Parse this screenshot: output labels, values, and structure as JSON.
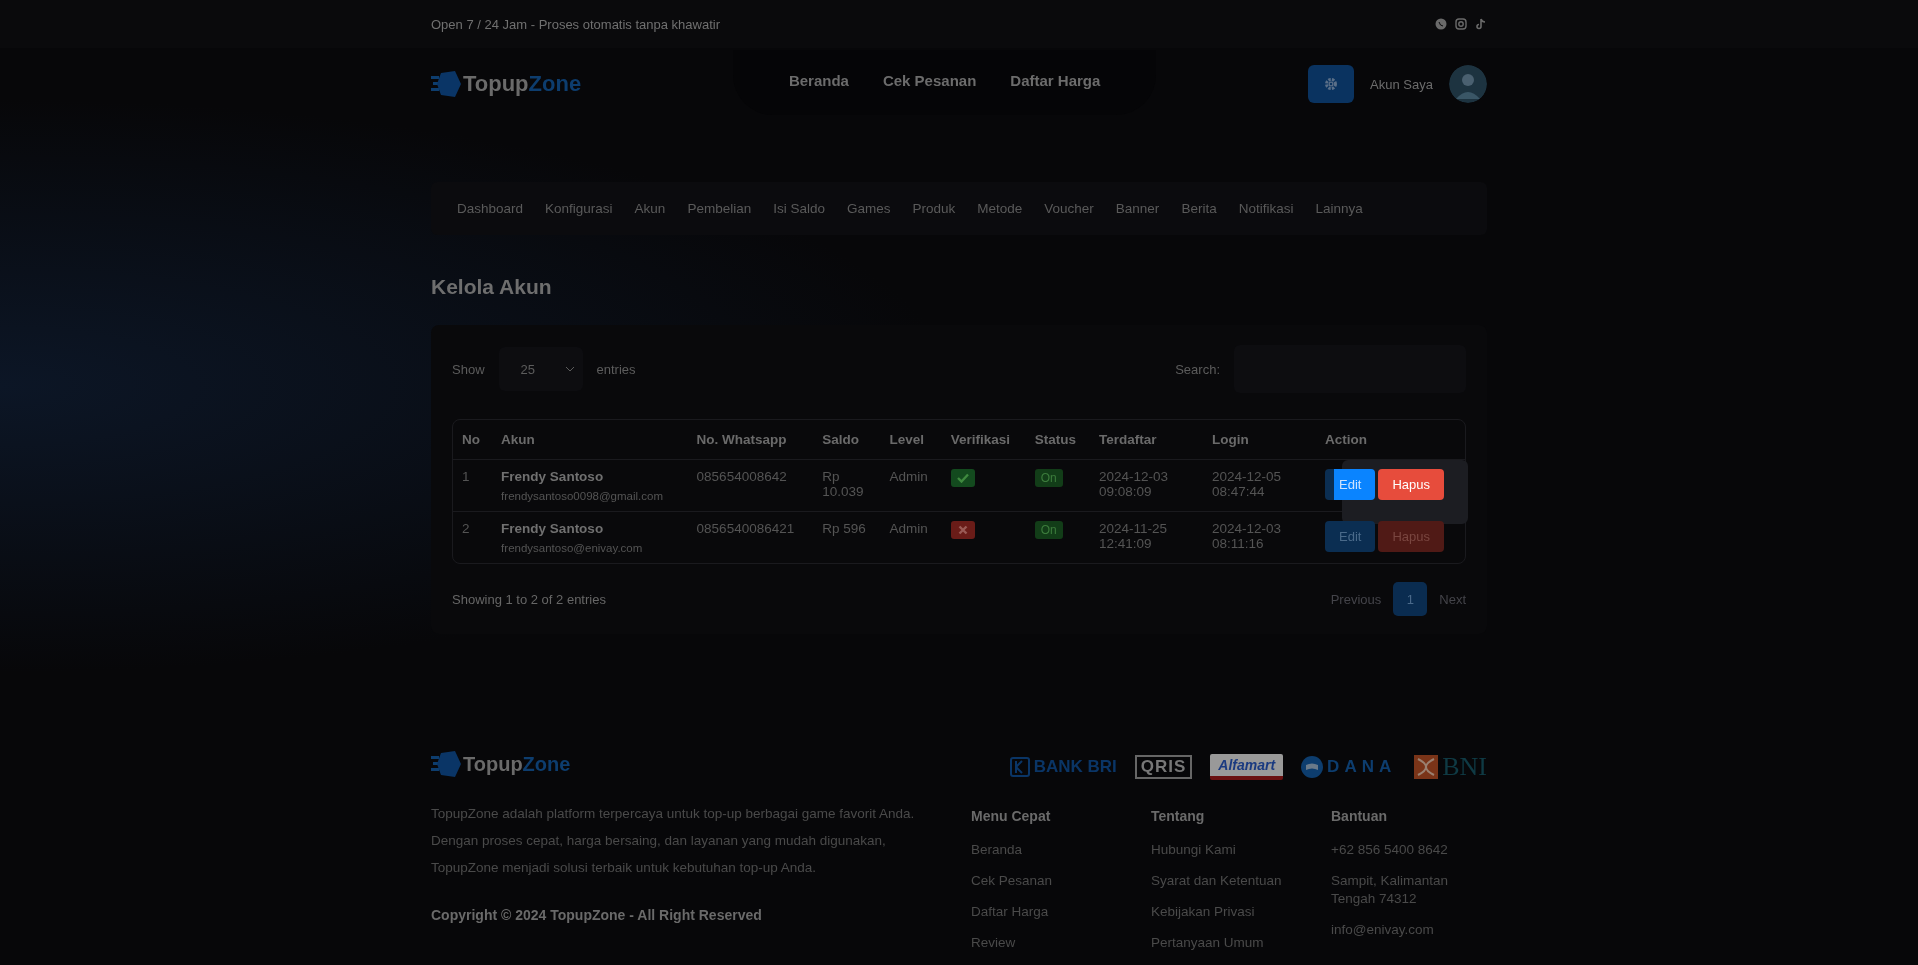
{
  "topbar": {
    "tagline": "Open 7 / 24 Jam - Proses otomatis tanpa khawatir"
  },
  "header": {
    "brand": [
      "Topup",
      "Zone"
    ],
    "nav": [
      "Beranda",
      "Cek Pesanan",
      "Daftar Harga"
    ],
    "account_label": "Akun Saya"
  },
  "admin_nav": [
    "Dashboard",
    "Konfigurasi",
    "Akun",
    "Pembelian",
    "Isi Saldo",
    "Games",
    "Produk",
    "Metode",
    "Voucher",
    "Banner",
    "Berita",
    "Notifikasi",
    "Lainnya"
  ],
  "page_title": "Kelola Akun",
  "table_controls": {
    "show_label": "Show",
    "page_size": "25",
    "entries_label": "entries",
    "search_label": "Search:"
  },
  "table": {
    "columns": [
      "No",
      "Akun",
      "No. Whatsapp",
      "Saldo",
      "Level",
      "Verifikasi",
      "Status",
      "Terdaftar",
      "Login",
      "Action"
    ],
    "rows": [
      {
        "no": "1",
        "name": "Frendy Santoso",
        "email": "frendysantoso0098@gmail.com",
        "whatsapp": "085654008642",
        "saldo": "Rp 10.039",
        "level": "Admin",
        "verified": true,
        "status": "On",
        "registered": "2024-12-03 09:08:09",
        "login": "2024-12-05 08:47:44",
        "actions": [
          "Edit",
          "Hapus"
        ],
        "spotlight": true
      },
      {
        "no": "2",
        "name": "Frendy Santoso",
        "email": "frendysantoso@enivay.com",
        "whatsapp": "0856540086421",
        "saldo": "Rp 596",
        "level": "Admin",
        "verified": false,
        "status": "On",
        "registered": "2024-11-25 12:41:09",
        "login": "2024-12-03 08:11:16",
        "actions": [
          "Edit",
          "Hapus"
        ],
        "spotlight": false
      }
    ]
  },
  "pagination": {
    "info": "Showing 1 to 2 of 2 entries",
    "previous": "Previous",
    "pages": [
      {
        "label": "1",
        "selected": true
      }
    ],
    "next": "Next"
  },
  "footer": {
    "brand": [
      "Topup",
      "Zone"
    ],
    "description": "TopupZone adalah platform terpercaya untuk top-up berbagai game favorit Anda. Dengan proses cepat, harga bersaing, dan layanan yang mudah digunakan, TopupZone menjadi solusi terbaik untuk kebutuhan top-up Anda.",
    "copyright": "Copyright © 2024 TopupZone - All Right Reserved",
    "payment_logos": [
      {
        "kind": "bri",
        "text": "BANK BRI"
      },
      {
        "kind": "qris",
        "text": "QRIS"
      },
      {
        "kind": "alfamart",
        "text": "Alfamart"
      },
      {
        "kind": "dana",
        "text": "DANA"
      },
      {
        "kind": "bni",
        "text": "BNI"
      }
    ],
    "columns": [
      {
        "heading": "Menu Cepat",
        "items": [
          "Beranda",
          "Cek Pesanan",
          "Daftar Harga",
          "Review"
        ]
      },
      {
        "heading": "Tentang",
        "items": [
          "Hubungi Kami",
          "Syarat dan Ketentuan",
          "Kebijakan Privasi",
          "Pertanyaan Umum"
        ]
      },
      {
        "heading": "Bantuan",
        "items": [
          "+62 856 5400 8642",
          "Sampit, Kalimantan Tengah 74312",
          "info@enivay.com"
        ]
      }
    ]
  }
}
